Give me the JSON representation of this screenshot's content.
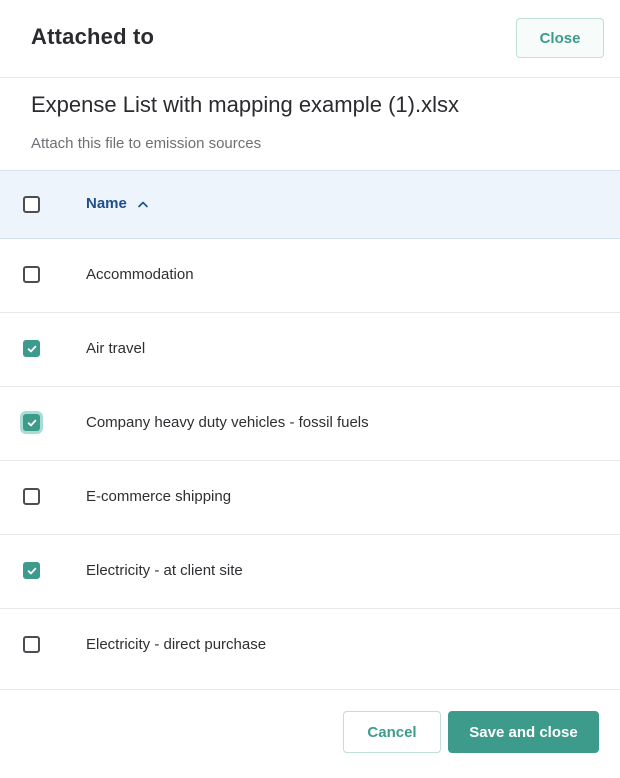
{
  "dialog": {
    "title": "Attached to",
    "close_label": "Close"
  },
  "file": {
    "name": "Expense List with mapping example (1).xlsx",
    "subtitle": "Attach this file to emission sources"
  },
  "table": {
    "header": {
      "name_label": "Name",
      "sort": "ascending",
      "sort_icon": "chevron-up-icon",
      "select_all_checked": false
    },
    "rows": [
      {
        "name": "Accommodation",
        "checked": false,
        "focused": false
      },
      {
        "name": "Air travel",
        "checked": true,
        "focused": false
      },
      {
        "name": "Company heavy duty vehicles - fossil fuels",
        "checked": true,
        "focused": true
      },
      {
        "name": "E-commerce shipping",
        "checked": false,
        "focused": false
      },
      {
        "name": "Electricity - at client site",
        "checked": true,
        "focused": false
      },
      {
        "name": "Electricity - direct purchase",
        "checked": false,
        "focused": false
      }
    ]
  },
  "footer": {
    "cancel_label": "Cancel",
    "save_label": "Save and close"
  },
  "colors": {
    "accent": "#3d9b8c",
    "header_bg": "#edf4fb",
    "header_text": "#1f4f8a"
  }
}
